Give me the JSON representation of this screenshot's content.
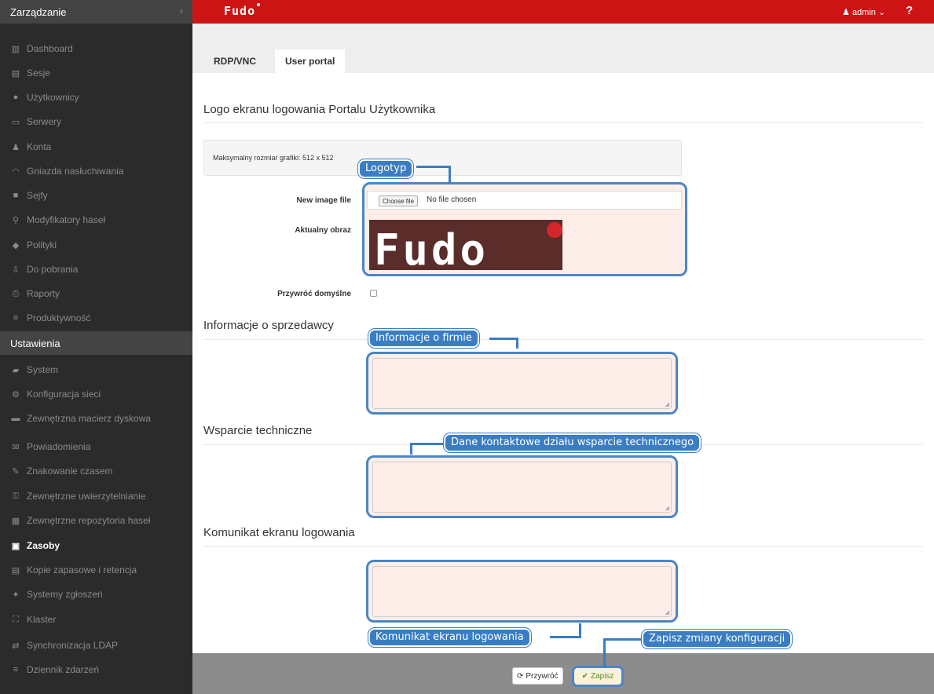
{
  "sidebar": {
    "section_management": "Zarządzanie",
    "collapse_icon": "chevron-left-icon",
    "management_items": [
      {
        "label": "Dashboard",
        "icon": "bar-chart-icon"
      },
      {
        "label": "Sesje",
        "icon": "film-icon"
      },
      {
        "label": "Użytkownicy",
        "icon": "users-icon"
      },
      {
        "label": "Serwery",
        "icon": "server-icon"
      },
      {
        "label": "Konta",
        "icon": "user-key-icon"
      },
      {
        "label": "Gniazda nasłuchiwania",
        "icon": "rss-icon"
      },
      {
        "label": "Sejfy",
        "icon": "safe-icon"
      },
      {
        "label": "Modyfikatory haseł",
        "icon": "sitemap-icon"
      },
      {
        "label": "Polityki",
        "icon": "shield-icon"
      },
      {
        "label": "Do pobrania",
        "icon": "download-icon"
      },
      {
        "label": "Raporty",
        "icon": "printer-icon"
      },
      {
        "label": "Produktywność",
        "icon": "list-icon"
      }
    ],
    "section_settings": "Ustawienia",
    "settings_items": [
      {
        "label": "System",
        "icon": "folder-open-icon"
      },
      {
        "label": "Konfiguracja sieci",
        "icon": "cogs-icon"
      },
      {
        "label": "Zewnętrzna macierz dyskowa",
        "icon": "folder-icon"
      },
      {
        "label": "Powiadomienia",
        "icon": "envelope-icon"
      },
      {
        "label": "Znakowanie czasem",
        "icon": "edit-icon"
      },
      {
        "label": "Zewnętrzne uwierzytelnianie",
        "icon": "key-icon"
      },
      {
        "label": "Zewnętrzne repozytoria haseł",
        "icon": "grid-icon"
      },
      {
        "label": "Zasoby",
        "icon": "image-icon",
        "active": true
      },
      {
        "label": "Kopie zapasowe i retencja",
        "icon": "archive-icon"
      },
      {
        "label": "Systemy zgłoszeń",
        "icon": "ticket-icon"
      },
      {
        "label": "Klaster",
        "icon": "cluster-icon"
      },
      {
        "label": "Synchronizacja LDAP",
        "icon": "exchange-icon"
      },
      {
        "label": "Dziennik zdarzeń",
        "icon": "align-justify-icon"
      }
    ]
  },
  "topbar": {
    "brand": "Fudo",
    "user_label": "admin",
    "help_label": "?"
  },
  "tabs": [
    {
      "label": "RDP/VNC",
      "active": false
    },
    {
      "label": "User portal",
      "active": true
    }
  ],
  "main": {
    "logo_section_title": "Logo ekranu logowania Portalu Użytkownika",
    "max_size_text": "Maksymalny rozmiar grafiki: 512 x 512",
    "new_image_label": "New image file",
    "choose_file_button": "Choose file",
    "no_file_text": "No file chosen",
    "current_image_label": "Aktualny obraz",
    "current_image_text": "Fudo",
    "restore_default_label": "Przywróć domyślne",
    "vendor_section_title": "Informacje o sprzedawcy",
    "support_section_title": "Wsparcie techniczne",
    "login_message_section_title": "Komunikat ekranu logowania"
  },
  "callouts": {
    "logo": "Logotyp",
    "company_info": "Informacje o firmie",
    "support_contact": "Dane kontaktowe działu wsparcie technicznego",
    "login_message": "Komunikat ekranu logowania",
    "save_changes": "Zapisz zmiany konfiguracji"
  },
  "footer": {
    "reset_button": "Przywróć",
    "save_button": "Zapisz"
  },
  "colors": {
    "topbar": "#cc1414",
    "sidebar": "#2b2b2b",
    "callout": "#3a7dc4",
    "save_text": "#4b8f29"
  }
}
